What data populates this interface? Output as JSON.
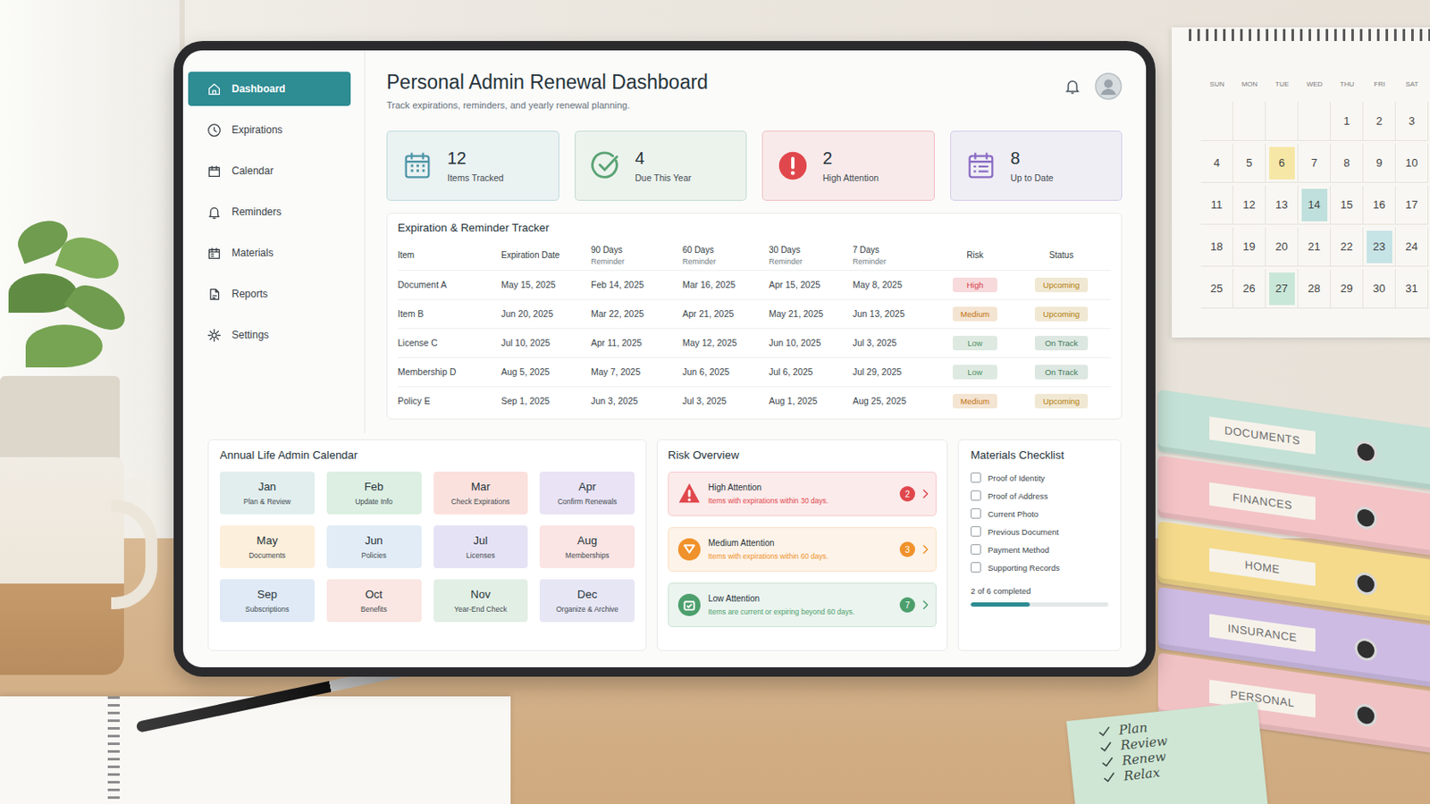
{
  "sidebar": {
    "items": [
      {
        "label": "Dashboard",
        "selected": true
      },
      {
        "label": "Expirations",
        "selected": false
      },
      {
        "label": "Calendar",
        "selected": false
      },
      {
        "label": "Reminders",
        "selected": false
      },
      {
        "label": "Materials",
        "selected": false
      },
      {
        "label": "Reports",
        "selected": false
      },
      {
        "label": "Settings",
        "selected": false
      }
    ]
  },
  "header": {
    "title": "Personal Admin Renewal Dashboard",
    "subtitle": "Track expirations, reminders, and yearly renewal planning."
  },
  "stats": [
    {
      "value": "12",
      "label": "Items Tracked",
      "kind": "calendar",
      "color": "#4f96a8"
    },
    {
      "value": "4",
      "label": "Due This Year",
      "kind": "check",
      "color": "#5aa374"
    },
    {
      "value": "2",
      "label": "High Attention",
      "kind": "alert",
      "color": "#e0474c"
    },
    {
      "value": "8",
      "label": "Up to Date",
      "kind": "list",
      "color": "#8a6cc4"
    }
  ],
  "tracker": {
    "title": "Expiration & Reminder Tracker",
    "columns": [
      {
        "label": "Item"
      },
      {
        "label": "Expiration Date"
      },
      {
        "label": "90 Days",
        "sub": "Reminder"
      },
      {
        "label": "60 Days",
        "sub": "Reminder"
      },
      {
        "label": "30 Days",
        "sub": "Reminder"
      },
      {
        "label": "7 Days",
        "sub": "Reminder"
      },
      {
        "label": "Risk"
      },
      {
        "label": "Status"
      }
    ],
    "rows": [
      {
        "item": "Document A",
        "expires": "May 15, 2025",
        "reminders": [
          "Feb 14, 2025",
          "Mar 16, 2025",
          "Apr 15, 2025",
          "May 8, 2025"
        ],
        "risk": {
          "label": "High",
          "color": "#d63b45"
        },
        "status": {
          "label": "Upcoming",
          "color": "#b07d0c"
        }
      },
      {
        "item": "Item B",
        "expires": "Jun 20, 2025",
        "reminders": [
          "Mar 22, 2025",
          "Apr 21, 2025",
          "May 21, 2025",
          "Jun 13, 2025"
        ],
        "risk": {
          "label": "Medium",
          "color": "#c2720f"
        },
        "status": {
          "label": "Upcoming",
          "color": "#b07d0c"
        }
      },
      {
        "item": "License C",
        "expires": "Jul 10, 2025",
        "reminders": [
          "Apr 11, 2025",
          "May 12, 2025",
          "Jun 10, 2025",
          "Jul 3, 2025"
        ],
        "risk": {
          "label": "Low",
          "color": "#4f8f5f"
        },
        "status": {
          "label": "On Track",
          "color": "#3f7a5a"
        }
      },
      {
        "item": "Membership D",
        "expires": "Aug 5, 2025",
        "reminders": [
          "May 7, 2025",
          "Jun 6, 2025",
          "Jul 6, 2025",
          "Jul 29, 2025"
        ],
        "risk": {
          "label": "Low",
          "color": "#4f8f5f"
        },
        "status": {
          "label": "On Track",
          "color": "#3f7a5a"
        }
      },
      {
        "item": "Policy E",
        "expires": "Sep 1, 2025",
        "reminders": [
          "Jun 3, 2025",
          "Jul 3, 2025",
          "Aug 1, 2025",
          "Aug 25, 2025"
        ],
        "risk": {
          "label": "Medium",
          "color": "#c2720f"
        },
        "status": {
          "label": "Upcoming",
          "color": "#b07d0c"
        }
      }
    ]
  },
  "calendar": {
    "title": "Annual Life Admin Calendar",
    "months": [
      {
        "name": "Jan",
        "task": "Plan & Review",
        "color": "#e2eeee"
      },
      {
        "name": "Feb",
        "task": "Update Info",
        "color": "#dcefe2"
      },
      {
        "name": "Mar",
        "task": "Check Expirations",
        "color": "#fbe1dd"
      },
      {
        "name": "Apr",
        "task": "Confirm Renewals",
        "color": "#e9e3f5"
      },
      {
        "name": "May",
        "task": "Documents",
        "color": "#fcefdb"
      },
      {
        "name": "Jun",
        "task": "Policies",
        "color": "#e2ecf6"
      },
      {
        "name": "Jul",
        "task": "Licenses",
        "color": "#e6e2f5"
      },
      {
        "name": "Aug",
        "task": "Memberships",
        "color": "#fbe4e4"
      },
      {
        "name": "Sep",
        "task": "Subscriptions",
        "color": "#e0eaf6"
      },
      {
        "name": "Oct",
        "task": "Benefits",
        "color": "#fae6e2"
      },
      {
        "name": "Nov",
        "task": "Year-End Check",
        "color": "#e2efe5"
      },
      {
        "name": "Dec",
        "task": "Organize & Archive",
        "color": "#e7e6f5"
      }
    ]
  },
  "risk": {
    "title": "Risk Overview",
    "items": [
      {
        "title": "High Attention",
        "desc": "Items with expirations within 30 days.",
        "count": "2",
        "color": "#e0474c"
      },
      {
        "title": "Medium Attention",
        "desc": "Items with expirations within 60 days.",
        "count": "3",
        "color": "#f0922b"
      },
      {
        "title": "Low Attention",
        "desc": "Items are current or expiring beyond 60 days.",
        "count": "7",
        "color": "#4c9f6c"
      }
    ]
  },
  "checklist": {
    "title": "Materials Checklist",
    "items": [
      {
        "label": "Proof of Identity",
        "checked": false
      },
      {
        "label": "Proof of Address",
        "checked": false
      },
      {
        "label": "Current Photo",
        "checked": false
      },
      {
        "label": "Previous Document",
        "checked": false
      },
      {
        "label": "Payment Method",
        "checked": false
      },
      {
        "label": "Supporting Records",
        "checked": false
      }
    ],
    "summary": "2 of 6 completed",
    "level": 0.43
  },
  "scene": {
    "wall_calendar": {
      "weekdays": [
        "SUN",
        "MON",
        "TUE",
        "WED",
        "THU",
        "FRI",
        "SAT"
      ],
      "leading_blanks": 4,
      "days": [
        {
          "label": "1",
          "marked": false
        },
        {
          "label": "2",
          "marked": false
        },
        {
          "label": "3",
          "marked": false
        },
        {
          "label": "4",
          "marked": false
        },
        {
          "label": "5",
          "marked": false
        },
        {
          "label": "6",
          "marked": true,
          "color": "#f7e7a6"
        },
        {
          "label": "7",
          "marked": false
        },
        {
          "label": "8",
          "marked": false
        },
        {
          "label": "9",
          "marked": false
        },
        {
          "label": "10",
          "marked": false
        },
        {
          "label": "11",
          "marked": false
        },
        {
          "label": "12",
          "marked": false
        },
        {
          "label": "13",
          "marked": false
        },
        {
          "label": "14",
          "marked": true,
          "color": "#bfe0dc"
        },
        {
          "label": "15",
          "marked": false
        },
        {
          "label": "16",
          "marked": false
        },
        {
          "label": "17",
          "marked": false
        },
        {
          "label": "18",
          "marked": false
        },
        {
          "label": "19",
          "marked": false
        },
        {
          "label": "20",
          "marked": false
        },
        {
          "label": "21",
          "marked": false
        },
        {
          "label": "22",
          "marked": false
        },
        {
          "label": "23",
          "marked": true,
          "color": "#c6e3e6"
        },
        {
          "label": "24",
          "marked": false
        },
        {
          "label": "25",
          "marked": false
        },
        {
          "label": "26",
          "marked": false
        },
        {
          "label": "27",
          "marked": true,
          "color": "#c9e7d8"
        },
        {
          "label": "28",
          "marked": false
        },
        {
          "label": "29",
          "marked": false
        },
        {
          "label": "30",
          "marked": false
        },
        {
          "label": "31",
          "marked": false
        }
      ]
    },
    "binders": [
      {
        "label": "DOCUMENTS",
        "color": "#c3e1d6"
      },
      {
        "label": "FINANCES",
        "color": "#f3c3c6"
      },
      {
        "label": "HOME",
        "color": "#f4da8a"
      },
      {
        "label": "INSURANCE",
        "color": "#cdbbe3"
      },
      {
        "label": "PERSONAL",
        "color": "#f1c2c4"
      }
    ],
    "sticky_note": [
      "Plan",
      "Review",
      "Renew",
      "Relax"
    ]
  }
}
